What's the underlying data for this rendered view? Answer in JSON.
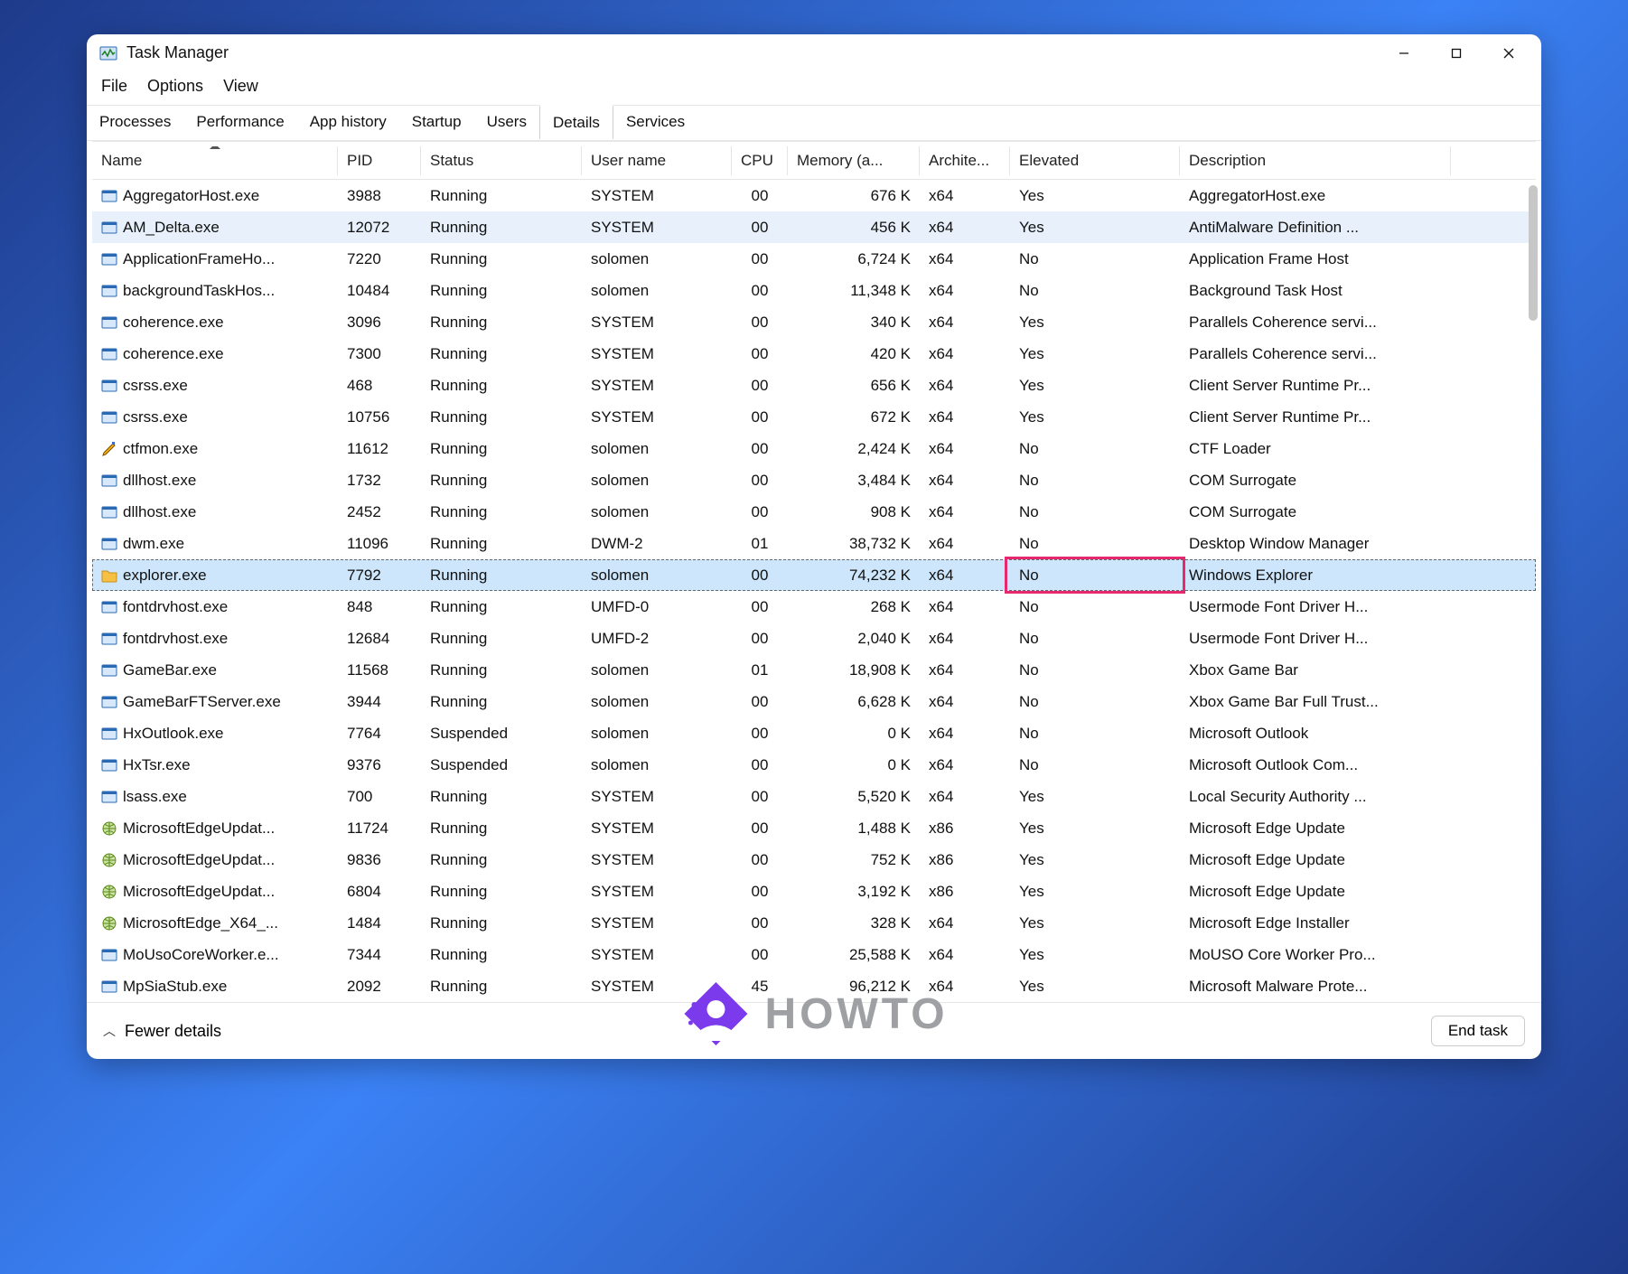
{
  "window": {
    "title": "Task Manager"
  },
  "menus": [
    "File",
    "Options",
    "View"
  ],
  "tabs": [
    "Processes",
    "Performance",
    "App history",
    "Startup",
    "Users",
    "Details",
    "Services"
  ],
  "activeTab": 5,
  "columns": [
    "Name",
    "PID",
    "Status",
    "User name",
    "CPU",
    "Memory (a...",
    "Archite...",
    "Elevated",
    "Description"
  ],
  "sortedColumn": 0,
  "footer": {
    "fewer": "Fewer details",
    "endTask": "End task"
  },
  "watermark": "HOWTO",
  "highlightRow": 13,
  "lightRow": 1,
  "rows": [
    {
      "icon": "app",
      "name": "AggregatorHost.exe",
      "pid": "3988",
      "status": "Running",
      "user": "SYSTEM",
      "cpu": "00",
      "mem": "676 K",
      "arch": "x64",
      "elev": "Yes",
      "desc": "AggregatorHost.exe"
    },
    {
      "icon": "app",
      "name": "AM_Delta.exe",
      "pid": "12072",
      "status": "Running",
      "user": "SYSTEM",
      "cpu": "00",
      "mem": "456 K",
      "arch": "x64",
      "elev": "Yes",
      "desc": "AntiMalware Definition ..."
    },
    {
      "icon": "app",
      "name": "ApplicationFrameHo...",
      "pid": "7220",
      "status": "Running",
      "user": "solomen",
      "cpu": "00",
      "mem": "6,724 K",
      "arch": "x64",
      "elev": "No",
      "desc": "Application Frame Host"
    },
    {
      "icon": "app",
      "name": "backgroundTaskHos...",
      "pid": "10484",
      "status": "Running",
      "user": "solomen",
      "cpu": "00",
      "mem": "11,348 K",
      "arch": "x64",
      "elev": "No",
      "desc": "Background Task Host"
    },
    {
      "icon": "app",
      "name": "coherence.exe",
      "pid": "3096",
      "status": "Running",
      "user": "SYSTEM",
      "cpu": "00",
      "mem": "340 K",
      "arch": "x64",
      "elev": "Yes",
      "desc": "Parallels Coherence servi..."
    },
    {
      "icon": "app",
      "name": "coherence.exe",
      "pid": "7300",
      "status": "Running",
      "user": "SYSTEM",
      "cpu": "00",
      "mem": "420 K",
      "arch": "x64",
      "elev": "Yes",
      "desc": "Parallels Coherence servi..."
    },
    {
      "icon": "app",
      "name": "csrss.exe",
      "pid": "468",
      "status": "Running",
      "user": "SYSTEM",
      "cpu": "00",
      "mem": "656 K",
      "arch": "x64",
      "elev": "Yes",
      "desc": "Client Server Runtime Pr..."
    },
    {
      "icon": "app",
      "name": "csrss.exe",
      "pid": "10756",
      "status": "Running",
      "user": "SYSTEM",
      "cpu": "00",
      "mem": "672 K",
      "arch": "x64",
      "elev": "Yes",
      "desc": "Client Server Runtime Pr..."
    },
    {
      "icon": "pen",
      "name": "ctfmon.exe",
      "pid": "11612",
      "status": "Running",
      "user": "solomen",
      "cpu": "00",
      "mem": "2,424 K",
      "arch": "x64",
      "elev": "No",
      "desc": "CTF Loader"
    },
    {
      "icon": "app",
      "name": "dllhost.exe",
      "pid": "1732",
      "status": "Running",
      "user": "solomen",
      "cpu": "00",
      "mem": "3,484 K",
      "arch": "x64",
      "elev": "No",
      "desc": "COM Surrogate"
    },
    {
      "icon": "app",
      "name": "dllhost.exe",
      "pid": "2452",
      "status": "Running",
      "user": "solomen",
      "cpu": "00",
      "mem": "908 K",
      "arch": "x64",
      "elev": "No",
      "desc": "COM Surrogate"
    },
    {
      "icon": "app",
      "name": "dwm.exe",
      "pid": "11096",
      "status": "Running",
      "user": "DWM-2",
      "cpu": "01",
      "mem": "38,732 K",
      "arch": "x64",
      "elev": "No",
      "desc": "Desktop Window Manager"
    },
    {
      "icon": "app",
      "name": "dwm.exe",
      "pid": "",
      "status": "",
      "user": "",
      "cpu": "",
      "mem": "",
      "arch": "",
      "elev": "",
      "desc": "",
      "hidden": true
    },
    {
      "icon": "folder",
      "name": "explorer.exe",
      "pid": "7792",
      "status": "Running",
      "user": "solomen",
      "cpu": "00",
      "mem": "74,232 K",
      "arch": "x64",
      "elev": "No",
      "desc": "Windows Explorer"
    },
    {
      "icon": "app",
      "name": "fontdrvhost.exe",
      "pid": "848",
      "status": "Running",
      "user": "UMFD-0",
      "cpu": "00",
      "mem": "268 K",
      "arch": "x64",
      "elev": "No",
      "desc": "Usermode Font Driver H..."
    },
    {
      "icon": "app",
      "name": "fontdrvhost.exe",
      "pid": "12684",
      "status": "Running",
      "user": "UMFD-2",
      "cpu": "00",
      "mem": "2,040 K",
      "arch": "x64",
      "elev": "No",
      "desc": "Usermode Font Driver H..."
    },
    {
      "icon": "app",
      "name": "GameBar.exe",
      "pid": "11568",
      "status": "Running",
      "user": "solomen",
      "cpu": "01",
      "mem": "18,908 K",
      "arch": "x64",
      "elev": "No",
      "desc": "Xbox Game Bar"
    },
    {
      "icon": "app",
      "name": "GameBarFTServer.exe",
      "pid": "3944",
      "status": "Running",
      "user": "solomen",
      "cpu": "00",
      "mem": "6,628 K",
      "arch": "x64",
      "elev": "No",
      "desc": "Xbox Game Bar Full Trust..."
    },
    {
      "icon": "app",
      "name": "HxOutlook.exe",
      "pid": "7764",
      "status": "Suspended",
      "user": "solomen",
      "cpu": "00",
      "mem": "0 K",
      "arch": "x64",
      "elev": "No",
      "desc": "Microsoft Outlook"
    },
    {
      "icon": "app",
      "name": "HxTsr.exe",
      "pid": "9376",
      "status": "Suspended",
      "user": "solomen",
      "cpu": "00",
      "mem": "0 K",
      "arch": "x64",
      "elev": "No",
      "desc": "Microsoft Outlook Com..."
    },
    {
      "icon": "app",
      "name": "lsass.exe",
      "pid": "700",
      "status": "Running",
      "user": "SYSTEM",
      "cpu": "00",
      "mem": "5,520 K",
      "arch": "x64",
      "elev": "Yes",
      "desc": "Local Security Authority ..."
    },
    {
      "icon": "globe",
      "name": "MicrosoftEdgeUpdat...",
      "pid": "11724",
      "status": "Running",
      "user": "SYSTEM",
      "cpu": "00",
      "mem": "1,488 K",
      "arch": "x86",
      "elev": "Yes",
      "desc": "Microsoft Edge Update"
    },
    {
      "icon": "globe",
      "name": "MicrosoftEdgeUpdat...",
      "pid": "9836",
      "status": "Running",
      "user": "SYSTEM",
      "cpu": "00",
      "mem": "752 K",
      "arch": "x86",
      "elev": "Yes",
      "desc": "Microsoft Edge Update"
    },
    {
      "icon": "globe",
      "name": "MicrosoftEdgeUpdat...",
      "pid": "6804",
      "status": "Running",
      "user": "SYSTEM",
      "cpu": "00",
      "mem": "3,192 K",
      "arch": "x86",
      "elev": "Yes",
      "desc": "Microsoft Edge Update"
    },
    {
      "icon": "globe",
      "name": "MicrosoftEdge_X64_...",
      "pid": "1484",
      "status": "Running",
      "user": "SYSTEM",
      "cpu": "00",
      "mem": "328 K",
      "arch": "x64",
      "elev": "Yes",
      "desc": "Microsoft Edge Installer"
    },
    {
      "icon": "app",
      "name": "MoUsoCoreWorker.e...",
      "pid": "7344",
      "status": "Running",
      "user": "SYSTEM",
      "cpu": "00",
      "mem": "25,588 K",
      "arch": "x64",
      "elev": "Yes",
      "desc": "MoUSO Core Worker Pro..."
    },
    {
      "icon": "app",
      "name": "MpSiaStub.exe",
      "pid": "2092",
      "status": "Running",
      "user": "SYSTEM",
      "cpu": "45",
      "mem": "96,212 K",
      "arch": "x64",
      "elev": "Yes",
      "desc": "Microsoft Malware Prote..."
    }
  ]
}
